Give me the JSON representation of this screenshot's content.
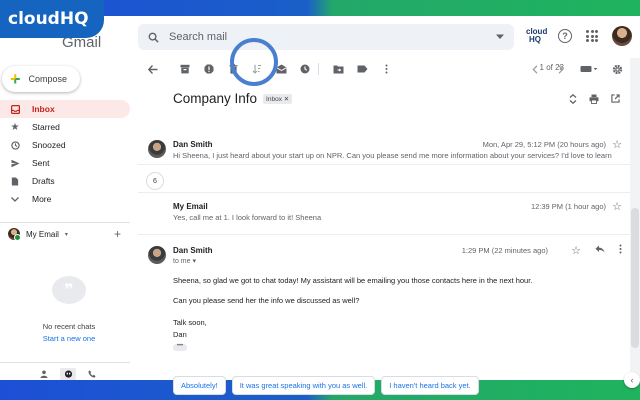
{
  "brand": {
    "name": "cloudHQ",
    "app_word": "Gmail"
  },
  "header": {
    "search_placeholder": "Search mail",
    "hq_badge": "cloud HQ",
    "help_glyph": "?"
  },
  "sidebar": {
    "compose_label": "Compose",
    "items": [
      {
        "label": "Inbox",
        "icon": "inbox-icon",
        "active": true
      },
      {
        "label": "Starred",
        "icon": "star-icon",
        "active": false
      },
      {
        "label": "Snoozed",
        "icon": "clock-icon",
        "active": false
      },
      {
        "label": "Sent",
        "icon": "send-icon",
        "active": false
      },
      {
        "label": "Drafts",
        "icon": "draft-icon",
        "active": false
      },
      {
        "label": "More",
        "icon": "chevron-down-icon",
        "active": false
      }
    ],
    "chat_user": "My Email",
    "chat_empty": "No recent chats",
    "chat_start": "Start a new one"
  },
  "toolbar": {
    "pager": "1 of 23"
  },
  "thread": {
    "subject": "Company Info",
    "label": "Inbox",
    "collapsed_count": "6",
    "messages": [
      {
        "sender": "Dan Smith",
        "time": "Mon, Apr 29, 5:12 PM (20 hours ago)",
        "snippet": "Hi Sheena, I just heard about your start up on NPR. Can you please send me more information about your services? I'd love to learn ..."
      },
      {
        "sender": "My Email",
        "time": "12:39 PM (1 hour ago)",
        "snippet": "Yes, call me at 1. I look forward to it! Sheena"
      }
    ],
    "open_message": {
      "sender": "Dan Smith",
      "to": "to me",
      "time": "1:29 PM (22 minutes ago)",
      "body": [
        "Sheena, so glad we got to chat today! My assistant will be emailing you those contacts here in the next hour.",
        "Can you please send her the info we discussed as well?",
        "Talk soon,",
        "Dan"
      ],
      "ellipsis": "•••"
    },
    "smart_replies": [
      "Absolutely!",
      "It was great speaking with you as well.",
      "I haven't heard back yet."
    ]
  },
  "colors": {
    "accent_blue": "#1a73e8",
    "inbox_red": "#c5221f",
    "highlight_ring": "#4a7fd0"
  }
}
